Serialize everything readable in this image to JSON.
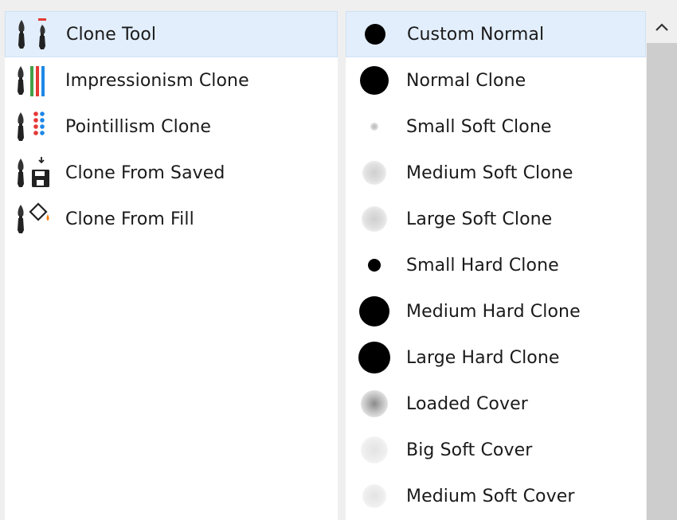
{
  "categories": [
    {
      "label": "Clone Tool",
      "icon": "clone-tool-icon",
      "selected": true
    },
    {
      "label": "Impressionism Clone",
      "icon": "impressionism-clone-icon",
      "selected": false
    },
    {
      "label": "Pointillism Clone",
      "icon": "pointillism-clone-icon",
      "selected": false
    },
    {
      "label": "Clone From Saved",
      "icon": "clone-from-saved-icon",
      "selected": false
    },
    {
      "label": "Clone From Fill",
      "icon": "clone-from-fill-icon",
      "selected": false
    }
  ],
  "variants": [
    {
      "label": "Custom Normal",
      "dab": "small-hard",
      "selected": true
    },
    {
      "label": "Normal Clone",
      "dab": "large-hard",
      "selected": false
    },
    {
      "label": "Small Soft Clone",
      "dab": "tiny-soft",
      "selected": false
    },
    {
      "label": "Medium Soft Clone",
      "dab": "medium-soft",
      "selected": false
    },
    {
      "label": "Large Soft Clone",
      "dab": "large-soft",
      "selected": false
    },
    {
      "label": "Small Hard Clone",
      "dab": "small-hard",
      "selected": false
    },
    {
      "label": "Medium Hard Clone",
      "dab": "large-hard",
      "selected": false
    },
    {
      "label": "Large Hard Clone",
      "dab": "large-hard",
      "selected": false
    },
    {
      "label": "Loaded Cover",
      "dab": "dark-soft",
      "selected": false
    },
    {
      "label": "Big Soft Cover",
      "dab": "faint-soft",
      "selected": false
    },
    {
      "label": "Medium Soft Cover",
      "dab": "faint-soft",
      "selected": false
    }
  ],
  "colors": {
    "selection": "#e2eefb",
    "selection_border": "#cfe1f5",
    "scrollbar_track": "#cdcdcd",
    "red": "#e53935",
    "green": "#43a047",
    "blue": "#1e88e5",
    "orange": "#f57c00"
  },
  "scroll_up_icon": "chevron-up-icon"
}
